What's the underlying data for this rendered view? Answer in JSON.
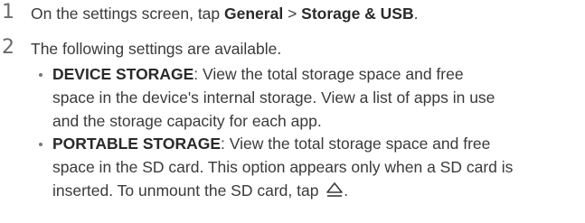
{
  "steps": [
    {
      "number": "1",
      "text_before": "On the settings screen, tap ",
      "path_part1": "General",
      "separator": " > ",
      "path_part2": "Storage & USB",
      "text_after": "."
    },
    {
      "number": "2",
      "text": "The following settings are available."
    }
  ],
  "options": [
    {
      "term": "DEVICE STORAGE",
      "line1": ": View the total storage space and free",
      "line2": "space in the device's internal storage. View a list of apps in use",
      "line3": "and the storage capacity for each app."
    },
    {
      "term": "PORTABLE STORAGE",
      "line1": ": View the total storage space and free",
      "line2": "space in the SD card. This option appears only when a SD card is",
      "line3": "inserted. To unmount the SD card, tap ",
      "line3_end": ".",
      "icon": "eject-icon"
    }
  ]
}
